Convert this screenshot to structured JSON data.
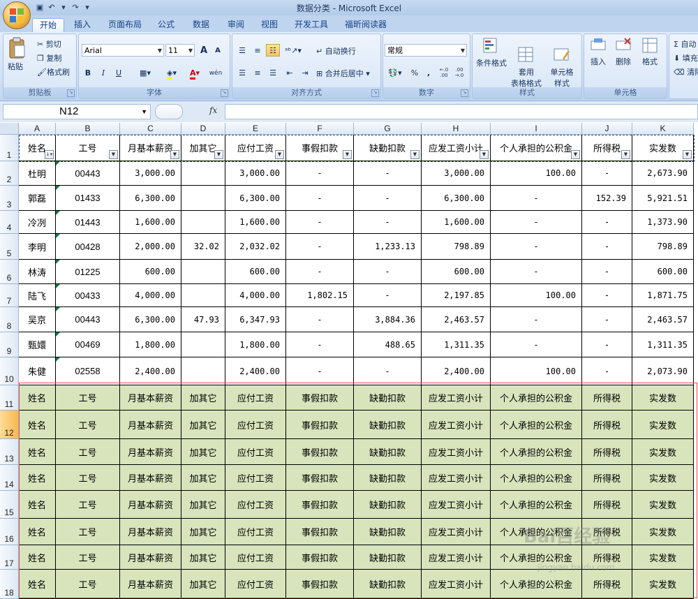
{
  "window": {
    "title": "数据分类 - Microsoft Excel"
  },
  "tabs": [
    {
      "label": "开始",
      "active": true
    },
    {
      "label": "插入"
    },
    {
      "label": "页面布局"
    },
    {
      "label": "公式"
    },
    {
      "label": "数据"
    },
    {
      "label": "审阅"
    },
    {
      "label": "视图"
    },
    {
      "label": "开发工具"
    },
    {
      "label": "福昕阅读器"
    }
  ],
  "ribbon": {
    "clipboard": {
      "label": "剪贴板",
      "paste": "粘贴",
      "cut": "剪切",
      "copy": "复制",
      "format_painter": "格式刷"
    },
    "font": {
      "label": "字体",
      "name": "Arial",
      "size": "11",
      "bold": "B",
      "italic": "I",
      "underline": "U",
      "grow": "A",
      "shrink": "A",
      "phonetic": "wén"
    },
    "alignment": {
      "label": "对齐方式",
      "wrap": "自动换行",
      "merge": "合并后居中"
    },
    "number": {
      "label": "数字",
      "format": "常规",
      "percent": "%",
      "comma": ",",
      "inc_decimal": "←.0 .00",
      "dec_decimal": ".00 →.0"
    },
    "styles": {
      "label": "样式",
      "conditional": "条件格式",
      "table": "套用\n表格格式",
      "cell_styles": "单元格\n样式"
    },
    "cells": {
      "label": "单元格",
      "insert": "插入",
      "delete": "删除",
      "format": "格式"
    },
    "editing": {
      "autosum": "Σ 自动",
      "fill": "填充",
      "clear": "清除"
    }
  },
  "formula_bar": {
    "name_box": "N12",
    "fx": "fx",
    "formula": ""
  },
  "columns": [
    "A",
    "B",
    "C",
    "D",
    "E",
    "F",
    "G",
    "H",
    "I",
    "J",
    "K"
  ],
  "headers": [
    "姓名",
    "工号",
    "月基本薪资",
    "加其它",
    "应付工资",
    "事假扣款",
    "缺勤扣款",
    "应发工资小计",
    "个人承担的公积金",
    "所得税",
    "实发数"
  ],
  "rows": [
    [
      "杜明",
      "00443",
      "3,000.00",
      "",
      "3,000.00",
      "-",
      "-",
      "3,000.00",
      "100.00",
      "-",
      "2,673.90"
    ],
    [
      "郭磊",
      "01433",
      "6,300.00",
      "",
      "6,300.00",
      "-",
      "-",
      "6,300.00",
      "-",
      "152.39",
      "5,921.51"
    ],
    [
      "冷冽",
      "01443",
      "1,600.00",
      "",
      "1,600.00",
      "-",
      "-",
      "1,600.00",
      "-",
      "-",
      "1,373.90"
    ],
    [
      "李明",
      "00428",
      "2,000.00",
      "32.02",
      "2,032.02",
      "-",
      "1,233.13",
      "798.89",
      "-",
      "-",
      "798.89"
    ],
    [
      "林涛",
      "01225",
      "600.00",
      "",
      "600.00",
      "-",
      "-",
      "600.00",
      "-",
      "-",
      "600.00"
    ],
    [
      "陆飞",
      "00433",
      "4,000.00",
      "",
      "4,000.00",
      "1,802.15",
      "-",
      "2,197.85",
      "100.00",
      "-",
      "1,871.75"
    ],
    [
      "吴京",
      "00443",
      "6,300.00",
      "47.93",
      "6,347.93",
      "-",
      "3,884.36",
      "2,463.57",
      "-",
      "-",
      "2,463.57"
    ],
    [
      "甄嬛",
      "00469",
      "1,800.00",
      "",
      "1,800.00",
      "-",
      "488.65",
      "1,311.35",
      "-",
      "-",
      "1,311.35"
    ],
    [
      "朱健",
      "02558",
      "2,400.00",
      "",
      "2,400.00",
      "-",
      "-",
      "2,400.00",
      "100.00",
      "-",
      "2,073.90"
    ]
  ],
  "green_row_count": 8,
  "row_numbers": [
    "1",
    "2",
    "3",
    "4",
    "5",
    "6",
    "7",
    "8",
    "9",
    "10",
    "11",
    "12",
    "13",
    "14",
    "15",
    "16",
    "17",
    "18"
  ],
  "selected_row": "12",
  "watermark": {
    "main": "Bai百经验",
    "sub": "jingyan.baidu.com"
  },
  "colors": {
    "green_fill": "#d8e4bc",
    "selection_border": "#e34b4b",
    "ribbon": "#cfdff4"
  }
}
